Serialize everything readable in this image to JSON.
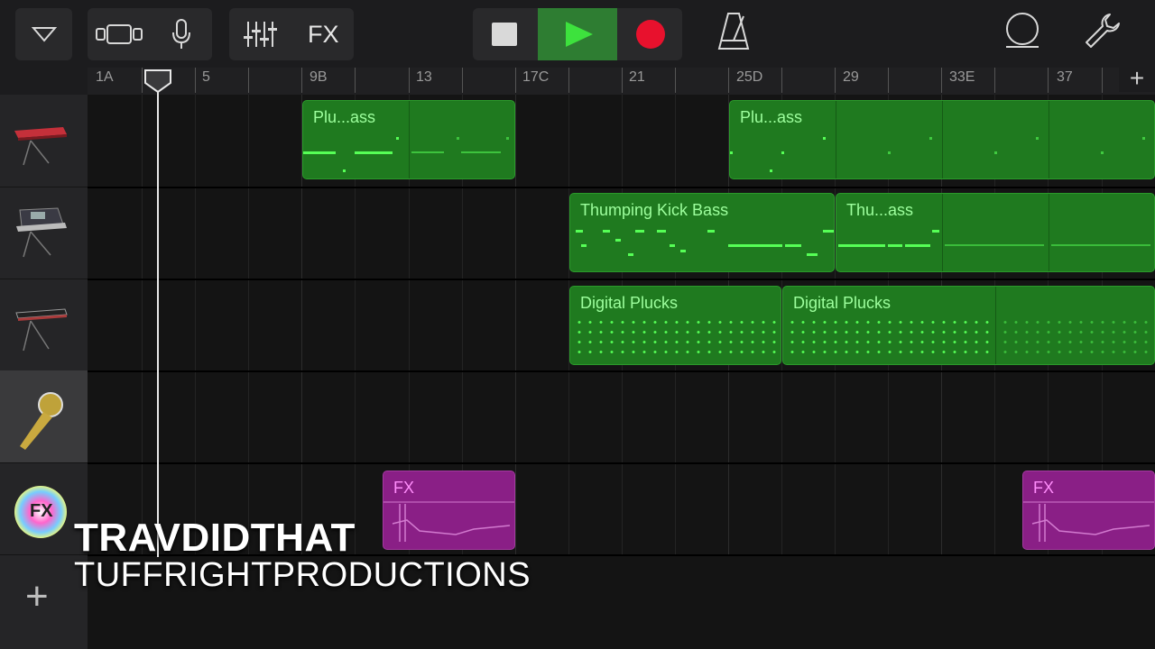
{
  "toolbar": {
    "fx_label": "FX",
    "transport": {
      "play_active": true
    },
    "colors": {
      "accent_green": "#2e7d32",
      "record_red": "#e8112d",
      "button_bg": "#29292b"
    }
  },
  "ruler": {
    "labels": [
      "1A",
      "5",
      "9B",
      "13",
      "17C",
      "21",
      "25D",
      "29",
      "33E",
      "37"
    ],
    "add_label": "+"
  },
  "tracks": [
    {
      "instrument": "red-keyboard",
      "regions": [
        {
          "label": "Plu...ass",
          "color": "green"
        },
        {
          "label": "Plu...ass",
          "color": "green"
        }
      ]
    },
    {
      "instrument": "synth-keyboard",
      "regions": [
        {
          "label": "Thumping Kick Bass",
          "color": "green"
        },
        {
          "label": "Thu...ass",
          "color": "green"
        }
      ]
    },
    {
      "instrument": "black-keyboard",
      "regions": [
        {
          "label": "Digital Plucks",
          "color": "green"
        },
        {
          "label": "Digital Plucks",
          "color": "green"
        }
      ]
    },
    {
      "instrument": "microphone",
      "regions": []
    },
    {
      "instrument": "fx",
      "regions": [
        {
          "label": "FX",
          "color": "magenta"
        },
        {
          "label": "FX",
          "color": "magenta"
        }
      ]
    }
  ],
  "fx_track_icon_label": "FX",
  "add_track_label": "+",
  "overlay": {
    "line1": "TRAVDIDTHAT",
    "line2": "TUFFRIGHTPRODUCTIONS"
  }
}
